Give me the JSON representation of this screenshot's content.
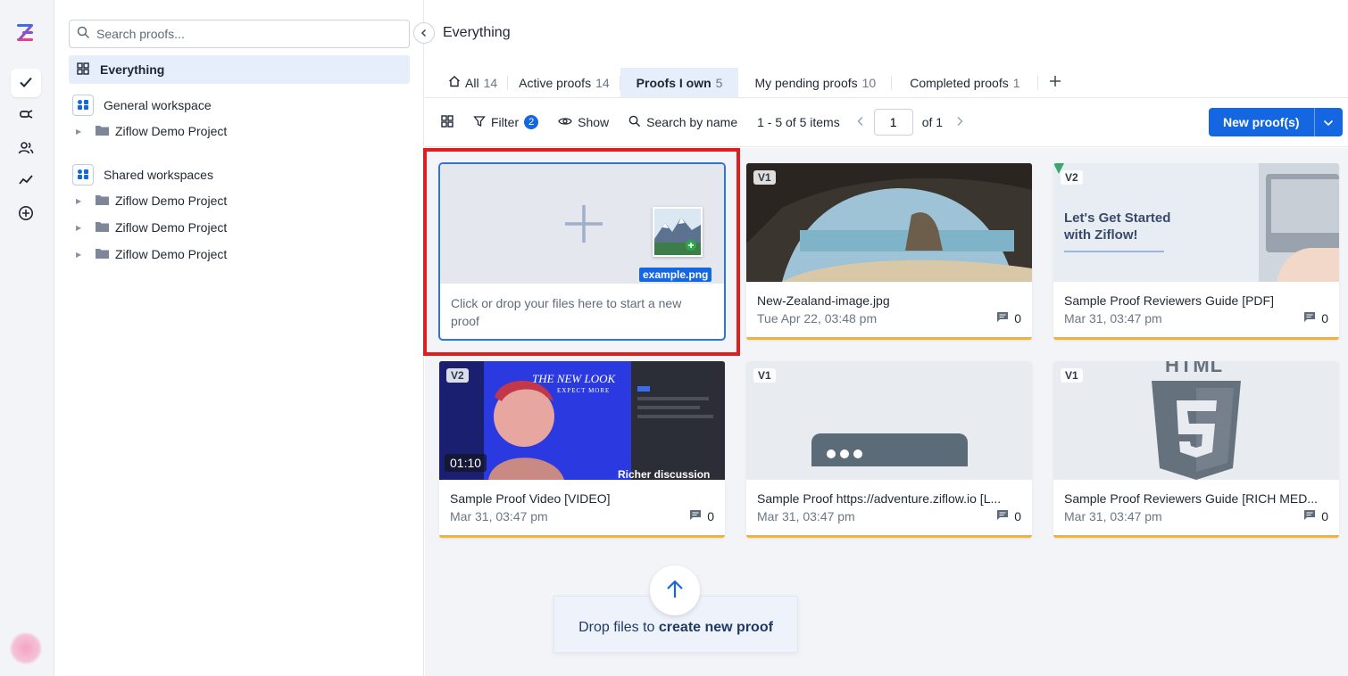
{
  "sidebar": {
    "search_placeholder": "Search proofs...",
    "everything_label": "Everything",
    "general_workspace": {
      "label": "General workspace",
      "projects": [
        "Ziflow Demo Project"
      ]
    },
    "shared_workspaces": {
      "label": "Shared workspaces",
      "projects": [
        "Ziflow Demo Project",
        "Ziflow Demo Project",
        "Ziflow Demo Project"
      ]
    }
  },
  "header": {
    "title": "Everything"
  },
  "tabs": [
    {
      "label": "All",
      "count": "14"
    },
    {
      "label": "Active proofs",
      "count": "14"
    },
    {
      "label": "Proofs I own",
      "count": "5",
      "active": true
    },
    {
      "label": "My pending proofs",
      "count": "10"
    },
    {
      "label": "Completed proofs",
      "count": "1"
    }
  ],
  "toolbar": {
    "filter_label": "Filter",
    "filter_count": "2",
    "show_label": "Show",
    "search_label": "Search by name",
    "range_text": "1 - 5 of 5 items",
    "page_value": "1",
    "of_text": "of 1",
    "new_proof_label": "New proof(s)"
  },
  "upload": {
    "hint": "Click or drop your files here to start a new proof",
    "file_chip": "example.png"
  },
  "proofs": [
    {
      "version": "V1",
      "title": "New-Zealand-image.jpg",
      "date": "Tue Apr 22, 03:48 pm",
      "comments": "0"
    },
    {
      "version": "V2",
      "title": "Sample Proof Reviewers Guide [PDF]",
      "date": "Mar 31, 03:47 pm",
      "comments": "0",
      "thumb_text": "Let's Get Started with Ziflow!"
    },
    {
      "version": "V2",
      "title": "Sample Proof Video [VIDEO]",
      "date": "Mar 31, 03:47 pm",
      "comments": "0",
      "duration": "01:10",
      "thumb_text": "THE NEW LOOK",
      "thumb_sub": "EXPECT MORE",
      "thumb_caption": "Richer discussion"
    },
    {
      "version": "V1",
      "title": "Sample Proof https://adventure.ziflow.io [L...",
      "date": "Mar 31, 03:47 pm",
      "comments": "0"
    },
    {
      "version": "V1",
      "title": "Sample Proof Reviewers Guide [RICH MED...",
      "date": "Mar 31, 03:47 pm",
      "comments": "0",
      "thumb_text": "HTML"
    }
  ],
  "dropzone": {
    "text_prefix": "Drop files to ",
    "text_bold": "create new proof"
  },
  "colors": {
    "accent": "#1467e0",
    "card_border": "#f0b23f",
    "highlight": "#e01e1e"
  }
}
